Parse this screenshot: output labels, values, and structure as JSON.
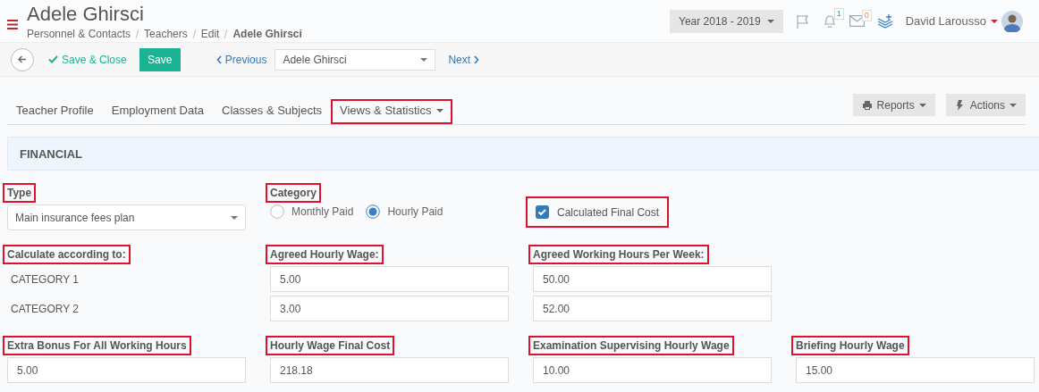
{
  "header": {
    "title": "Adele Ghirsci",
    "breadcrumbs": [
      {
        "label": "Personnel & Contacts",
        "current": false
      },
      {
        "label": "Teachers",
        "current": false
      },
      {
        "label": "Edit",
        "current": false
      },
      {
        "label": "Adele Ghirsci",
        "current": true
      }
    ],
    "year": "Year 2018 - 2019",
    "notification_count": "1",
    "message_count": "0",
    "user": "David Larousso"
  },
  "toolbar": {
    "save_close": "Save & Close",
    "save": "Save",
    "previous": "Previous",
    "record": "Adele Ghirsci",
    "next": "Next"
  },
  "tabs": [
    {
      "label": "Teacher Profile",
      "dropdown": false,
      "highlighted": false
    },
    {
      "label": "Employment Data",
      "dropdown": false,
      "highlighted": false
    },
    {
      "label": "Classes & Subjects",
      "dropdown": false,
      "highlighted": false
    },
    {
      "label": "Views & Statistics",
      "dropdown": true,
      "highlighted": true
    }
  ],
  "tab_buttons": [
    {
      "kind": "printer",
      "label": "Reports"
    },
    {
      "kind": "bolt",
      "label": "Actions"
    }
  ],
  "section": "FINANCIAL",
  "rows": [
    [
      {
        "kind": "select",
        "label": "Type",
        "highlighted": true,
        "value": "Main insurance fees plan"
      },
      {
        "kind": "radio",
        "label": "Category",
        "highlighted": true,
        "options": [
          {
            "label": "Monthly Paid",
            "selected": false
          },
          {
            "label": "Hourly Paid",
            "selected": true
          }
        ]
      },
      {
        "kind": "checkbox",
        "label": "Calculated Final Cost",
        "checked": true,
        "highlighted": true
      }
    ],
    [
      {
        "kind": "list",
        "label": "Calculate according to:",
        "highlighted": true,
        "items": [
          "CATEGORY 1",
          "CATEGORY 2"
        ]
      },
      {
        "kind": "inputs",
        "label": "Agreed Hourly Wage:",
        "highlighted": true,
        "values": [
          "5.00",
          "3.00"
        ]
      },
      {
        "kind": "inputs",
        "label": "Agreed Working Hours Per Week:",
        "highlighted": true,
        "values": [
          "50.00",
          "52.00"
        ]
      }
    ],
    [
      {
        "kind": "inputs",
        "label": "Extra Bonus For All Working Hours",
        "highlighted": true,
        "values": [
          "5.00"
        ]
      },
      {
        "kind": "inputs",
        "label": "Hourly Wage Final Cost",
        "highlighted": true,
        "values": [
          "218.18"
        ]
      },
      {
        "kind": "inputs",
        "label": "Examination Supervising Hourly Wage",
        "highlighted": true,
        "values": [
          "10.00"
        ]
      },
      {
        "kind": "inputs",
        "label": "Briefing Hourly Wage",
        "highlighted": true,
        "values": [
          "15.00"
        ]
      }
    ]
  ]
}
